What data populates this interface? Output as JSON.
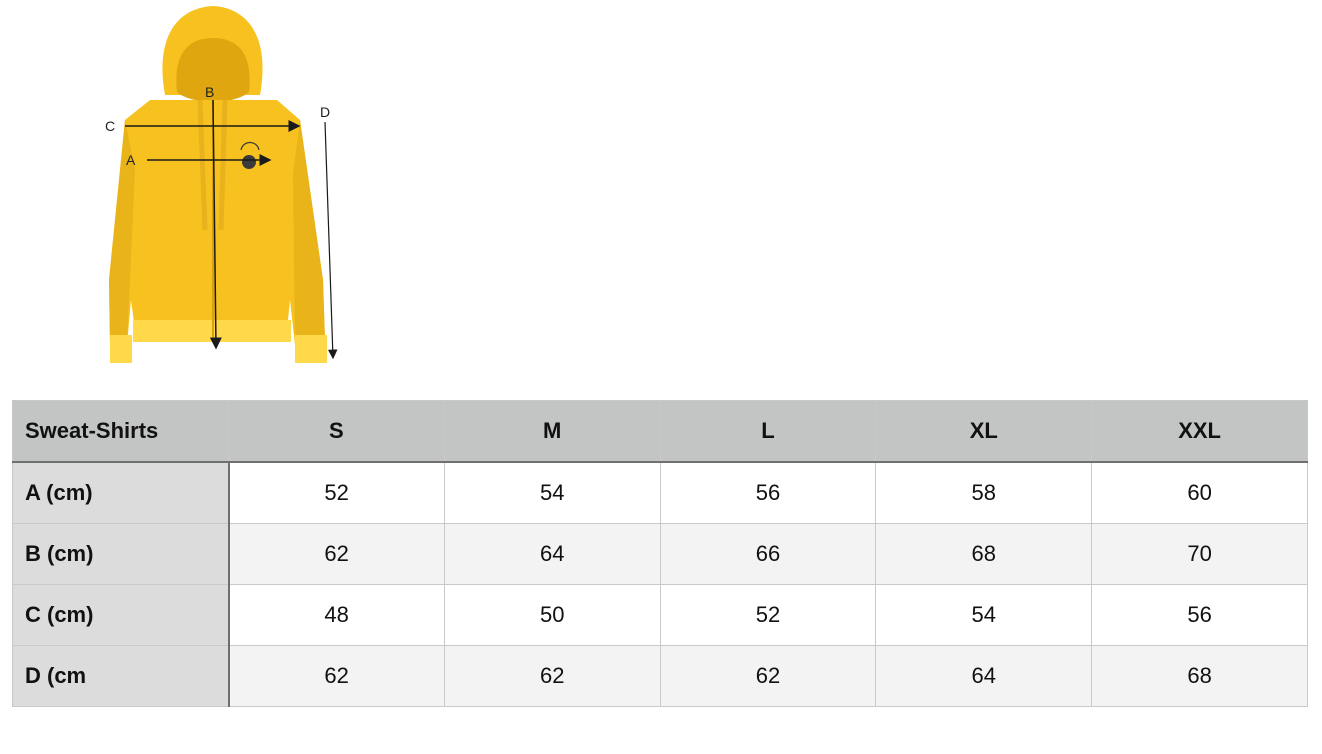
{
  "figure": {
    "labels": {
      "a": "A",
      "b": "B",
      "c": "C",
      "d": "D"
    },
    "colors": {
      "hoodie": "#f7c21f",
      "hoodie_shadow": "#e0a60f",
      "hoodie_light": "#ffd94a",
      "arrow": "#1a1a1a"
    }
  },
  "table": {
    "corner": "Sweat-Shirts",
    "columns": [
      "S",
      "M",
      "L",
      "XL",
      "XXL"
    ],
    "rows": [
      {
        "label": "A (cm)",
        "values": [
          "52",
          "54",
          "56",
          "58",
          "60"
        ]
      },
      {
        "label": "B (cm)",
        "values": [
          "62",
          "64",
          "66",
          "68",
          "70"
        ]
      },
      {
        "label": "C (cm)",
        "values": [
          "48",
          "50",
          "52",
          "54",
          "56"
        ]
      },
      {
        "label": "D (cm",
        "values": [
          "62",
          "62",
          "62",
          "64",
          "68"
        ]
      }
    ],
    "colors": {
      "header_bg": "#c3c5c4",
      "row_header_bg": "#dcdcdc",
      "stripe_bg": "#f3f3f3",
      "border": "#c9c9c9",
      "divider": "#6f6f6f"
    }
  }
}
